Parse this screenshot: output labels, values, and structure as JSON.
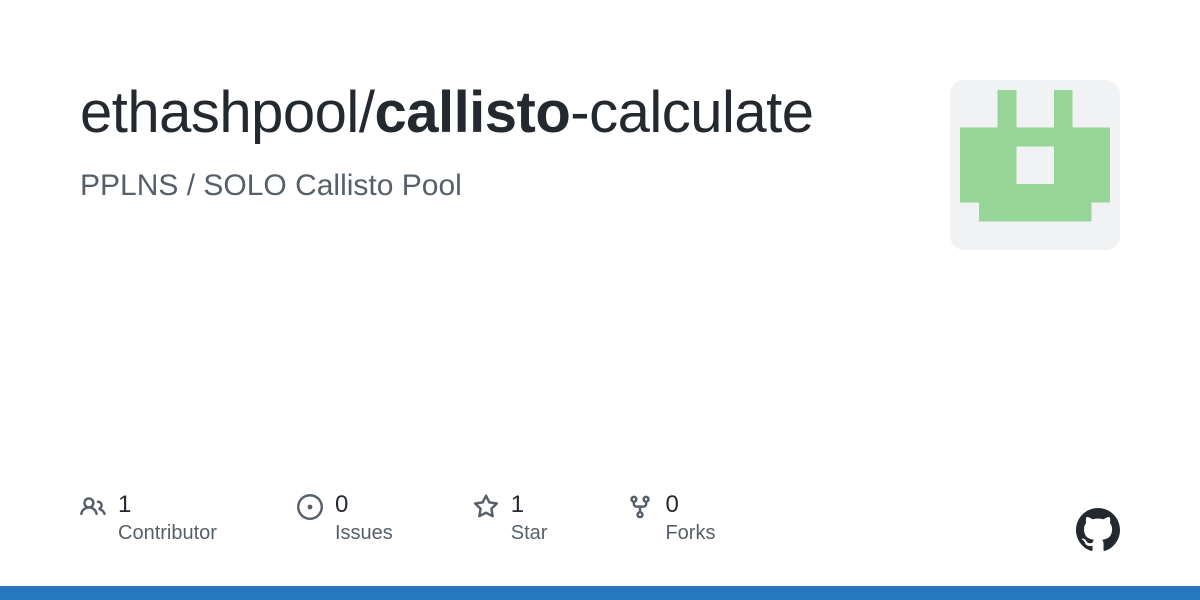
{
  "repo": {
    "owner": "ethashpool",
    "slash": "/",
    "name_part1": "callisto",
    "name_hyphen": "-",
    "name_part2": "calculate",
    "description": "PPLNS / SOLO Callisto Pool"
  },
  "stats": {
    "contributors": {
      "count": "1",
      "label": "Contributor"
    },
    "issues": {
      "count": "0",
      "label": "Issues"
    },
    "stars": {
      "count": "1",
      "label": "Star"
    },
    "forks": {
      "count": "0",
      "label": "Forks"
    }
  },
  "colors": {
    "accent": "#2677bd",
    "avatar_fg": "#97d497"
  }
}
